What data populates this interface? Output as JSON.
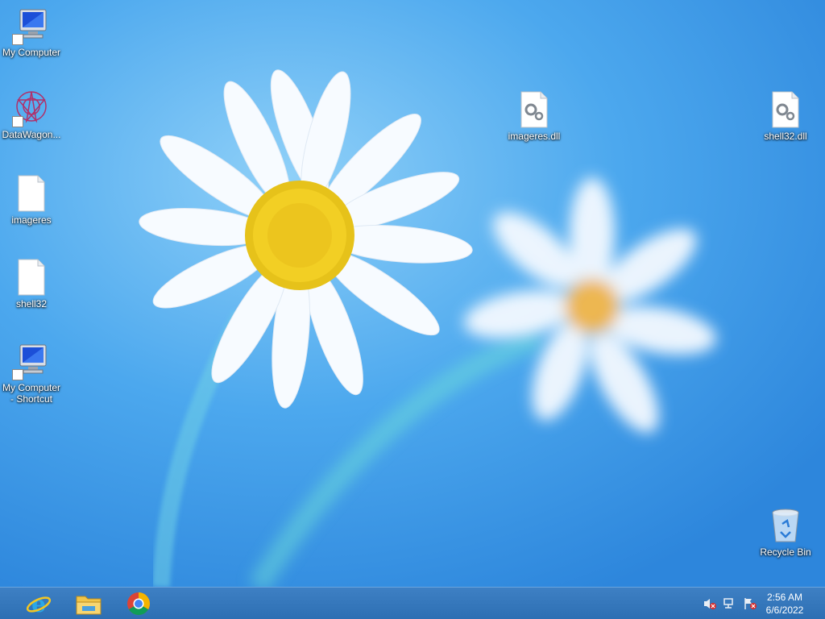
{
  "desktop": {
    "icons": [
      {
        "label": "My Computer",
        "icon": "computer-icon"
      },
      {
        "label": "DataWagon...",
        "icon": "datawagon-icon"
      },
      {
        "label": "imageres",
        "icon": "blank-file-icon"
      },
      {
        "label": "shell32",
        "icon": "blank-file-icon"
      },
      {
        "label": "My Computer - Shortcut",
        "icon": "computer-icon"
      },
      {
        "label": "imageres.dll",
        "icon": "dll-file-icon"
      },
      {
        "label": "shell32.dll",
        "icon": "dll-file-icon"
      },
      {
        "label": "Recycle Bin",
        "icon": "recycle-bin-icon"
      }
    ]
  },
  "taskbar": {
    "pinned": [
      {
        "name": "internet-explorer-icon"
      },
      {
        "name": "file-explorer-icon"
      },
      {
        "name": "chrome-icon"
      }
    ],
    "tray": [
      "volume-muted-icon",
      "network-icon",
      "action-center-flag-icon"
    ],
    "clock": {
      "time": "2:56 AM",
      "date": "6/6/2022"
    }
  }
}
